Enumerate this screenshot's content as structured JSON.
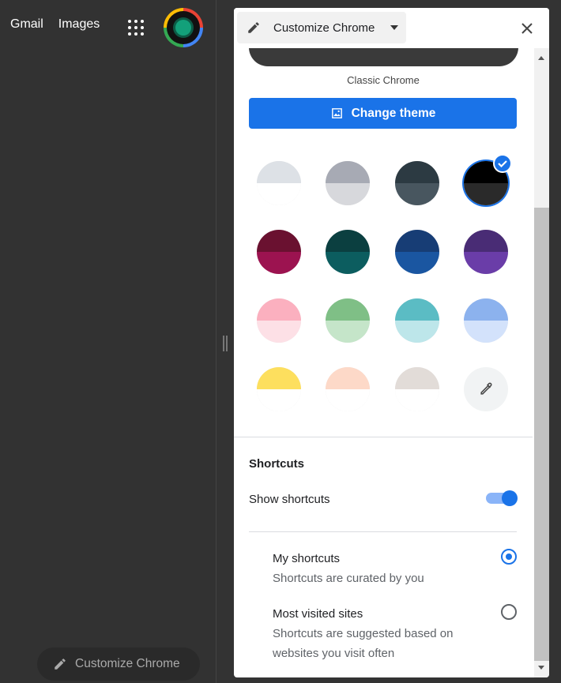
{
  "page": {
    "nav": {
      "gmail": "Gmail",
      "images": "Images"
    },
    "customize_chip": "Customize Chrome"
  },
  "panel": {
    "dropdown_label": "Customize Chrome",
    "classic_label": "Classic Chrome",
    "change_theme_label": "Change theme",
    "swatches": [
      {
        "top": "#dde1e6",
        "bottom": "#ffffff",
        "selected": false
      },
      {
        "top": "#a7aab4",
        "bottom": "#d7d8dc",
        "selected": false
      },
      {
        "top": "#2c3a42",
        "bottom": "#48565f",
        "selected": false
      },
      {
        "top": "#000000",
        "bottom": "#2a2a2a",
        "selected": true
      },
      {
        "top": "#6a1130",
        "bottom": "#9c1350",
        "selected": false
      },
      {
        "top": "#0b3f40",
        "bottom": "#0c5d5f",
        "selected": false
      },
      {
        "top": "#173d75",
        "bottom": "#1a56a1",
        "selected": false
      },
      {
        "top": "#492c75",
        "bottom": "#6a3da8",
        "selected": false
      },
      {
        "top": "#fbb0bf",
        "bottom": "#fde0e6",
        "selected": false
      },
      {
        "top": "#7fbf86",
        "bottom": "#c5e5c9",
        "selected": false
      },
      {
        "top": "#5bbcc4",
        "bottom": "#bde6ea",
        "selected": false
      },
      {
        "top": "#8cb2ee",
        "bottom": "#d3e2fb",
        "selected": false
      },
      {
        "top": "#fddf5e",
        "bottom": "#ffffff",
        "selected": false
      },
      {
        "top": "#fdd9c8",
        "bottom": "#ffffff",
        "selected": false
      },
      {
        "top": "#e2dcd8",
        "bottom": "#ffffff",
        "selected": false
      }
    ],
    "shortcuts": {
      "title": "Shortcuts",
      "show_label": "Show shortcuts",
      "show_enabled": true,
      "options": [
        {
          "title": "My shortcuts",
          "desc": "Shortcuts are curated by you",
          "selected": true
        },
        {
          "title": "Most visited sites",
          "desc": "Shortcuts are suggested based on websites you visit often",
          "selected": false
        }
      ]
    }
  },
  "colors": {
    "accent": "#1a73e8",
    "page_bg": "#333333"
  }
}
